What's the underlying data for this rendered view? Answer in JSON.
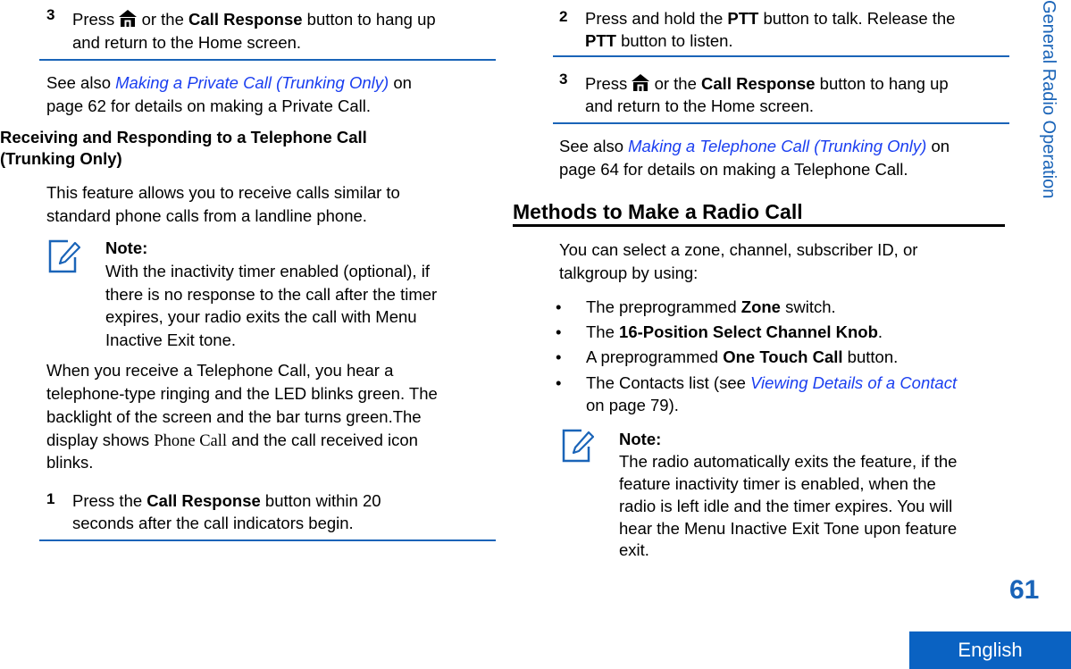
{
  "left_column": {
    "step3": {
      "number": "3",
      "pre": "Press ",
      "icon": "home-icon",
      "mid": " or the ",
      "bold": "Call Response",
      "post": " button to hang up",
      "line2": "and return to the Home screen."
    },
    "see_also": {
      "pre": "See also ",
      "link": "Making a Private Call (Trunking Only)",
      "post": " on",
      "line2": "page 62 for details on making a Private Call."
    },
    "section_heading": {
      "line1": "Receiving and Responding to a Telephone Call",
      "line2": "(Trunking Only)"
    },
    "intro": {
      "line1": "This feature allows you to receive calls similar to",
      "line2": "standard phone calls from a landline phone."
    },
    "note": {
      "icon": "note-pencil-icon",
      "title": "Note:",
      "lines": [
        "With the inactivity timer enabled (optional), if",
        "there is no response to the call after the timer",
        "expires, your radio exits the call with Menu",
        "Inactive Exit tone."
      ]
    },
    "receive_para": {
      "line1": "When you receive a Telephone Call, you hear a",
      "line2": "telephone-type ringing and the LED blinks green. The",
      "line3": "backlight of the screen and the bar turns green.The",
      "line4_pre": "display shows ",
      "line4_display": "Phone Call",
      "line4_post": " and the call received icon",
      "line5": "blinks."
    },
    "step1": {
      "number": "1",
      "pre": "Press the ",
      "bold": "Call Response",
      "post": " button within 20",
      "line2": "seconds after the call indicators begin."
    }
  },
  "right_column": {
    "step2": {
      "number": "2",
      "pre": "Press and hold the ",
      "bold1": "PTT",
      "post1": " button to talk. Release the",
      "bold2": "PTT",
      "post2": " button to listen."
    },
    "step3": {
      "number": "3",
      "pre": "Press ",
      "icon": "home-icon",
      "mid": " or the ",
      "bold": "Call Response",
      "post": " button to hang up",
      "line2": "and return to the Home screen."
    },
    "see_also": {
      "pre": "See also ",
      "link": "Making a Telephone Call (Trunking Only)",
      "post": " on",
      "line2": "page 64 for details on making a Telephone Call."
    },
    "section_heading": "Methods to Make a Radio Call",
    "intro": {
      "line1": "You can select a zone, channel, subscriber ID, or",
      "line2": "talkgroup by using:"
    },
    "bullets": [
      {
        "pre": "The preprogrammed ",
        "bold": "Zone",
        "post": " switch."
      },
      {
        "pre": "The ",
        "bold": "16-Position Select Channel Knob",
        "post": "."
      },
      {
        "pre": "A preprogrammed ",
        "bold": "One Touch Call",
        "post": " button."
      },
      {
        "pre": "The Contacts list (see ",
        "link": "Viewing Details of a Contact",
        "line2": "on page 79)."
      }
    ],
    "bullet_char": "•",
    "note": {
      "icon": "note-pencil-icon",
      "title": "Note:",
      "lines": [
        "The radio automatically exits the feature, if the",
        "feature inactivity timer is enabled, when the",
        "radio is left idle and the timer expires. You will",
        "hear the Menu Inactive Exit Tone upon feature",
        "exit."
      ]
    }
  },
  "sidebar": {
    "chapter_title": "General Radio Operation",
    "page_number": "61",
    "language_tab": "English"
  },
  "colors": {
    "accent_blue": "#1a64b8",
    "link_blue": "#1a3ef0",
    "language_tab_bg": "#0a62c2"
  }
}
